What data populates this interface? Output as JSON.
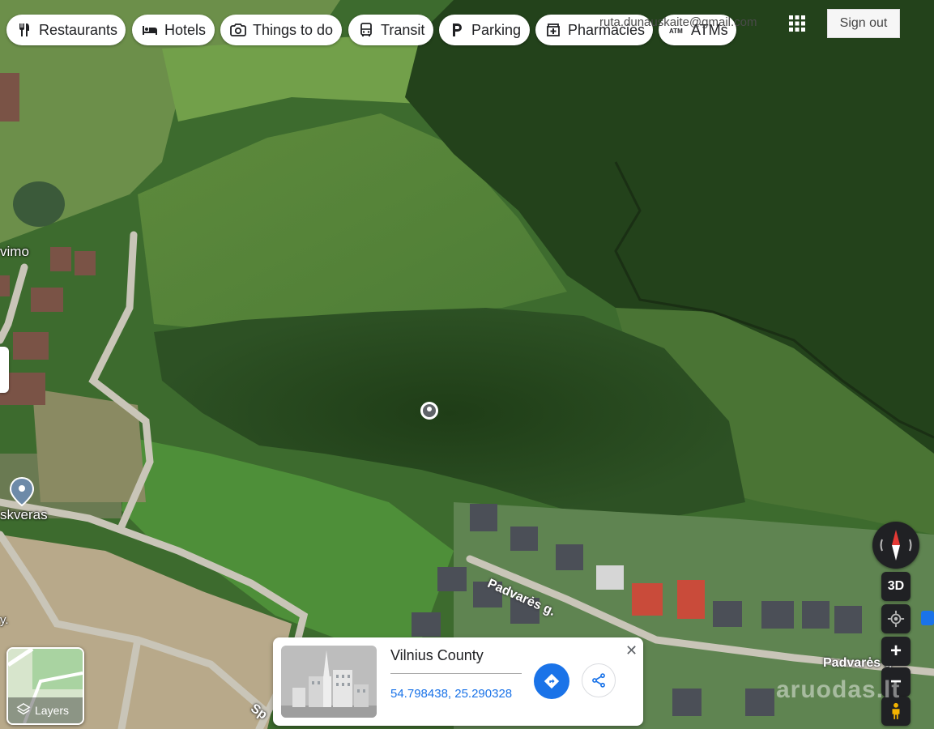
{
  "categories": [
    {
      "label": "Restaurants",
      "icon": "fork-knife-icon"
    },
    {
      "label": "Hotels",
      "icon": "bed-icon"
    },
    {
      "label": "Things to do",
      "icon": "camera-icon"
    },
    {
      "label": "Transit",
      "icon": "bus-icon"
    },
    {
      "label": "Parking",
      "icon": "parking-icon"
    },
    {
      "label": "Pharmacies",
      "icon": "pharmacy-icon"
    },
    {
      "label": "ATMs",
      "icon": "atm-icon"
    }
  ],
  "account": {
    "email": "ruta.dunauskaite@gmail.com",
    "sign_out": "Sign out"
  },
  "map": {
    "labels": {
      "place_left_top": "vimo",
      "place_left_mid": "skveras",
      "road_right_top": "Padvarės g.",
      "road_right_bottom": "Padvarės g",
      "road_bottom": "Sp",
      "left_edge": "y."
    }
  },
  "controls": {
    "three_d": "3D",
    "zoom_in": "+",
    "zoom_out": "−"
  },
  "layers": {
    "label": "Layers"
  },
  "place_card": {
    "title": "Vilnius County",
    "coordinates": "54.798438, 25.290328"
  },
  "watermark": "aruodas.lt",
  "colors": {
    "accent_blue": "#1a73e8",
    "compass_red": "#e53935"
  }
}
